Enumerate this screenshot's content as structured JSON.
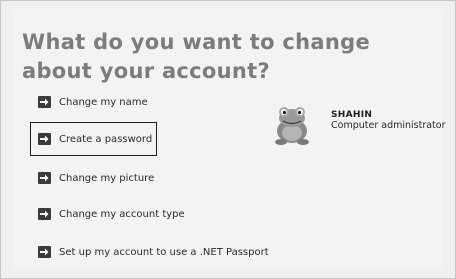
{
  "page": {
    "title": "What do you want to change about your account?"
  },
  "tasks": [
    {
      "label": "Change my name",
      "icon": "arrow-right-icon"
    },
    {
      "label": "Create a password",
      "icon": "arrow-right-icon"
    },
    {
      "label": "Change my picture",
      "icon": "arrow-right-icon"
    },
    {
      "label": "Change my account type",
      "icon": "arrow-right-icon"
    },
    {
      "label": "Set up my account to use a .NET Passport",
      "icon": "arrow-right-icon"
    }
  ],
  "account": {
    "name": "SHAHIN",
    "type": "Computer administrator",
    "picture": "frog-avatar"
  },
  "colors": {
    "title": "#7c7c7c",
    "background": "#f3f3f3",
    "arrow_bg": "#3a3a3a"
  }
}
